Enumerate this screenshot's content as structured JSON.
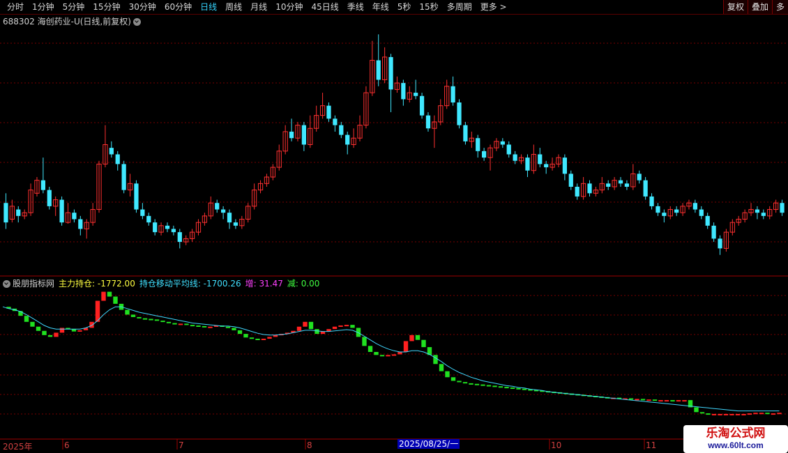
{
  "toolbar": {
    "tabs": [
      "分时",
      "1分钟",
      "5分钟",
      "15分钟",
      "30分钟",
      "60分钟",
      "日线",
      "周线",
      "月线",
      "10分钟",
      "45日线",
      "季线",
      "年线",
      "5秒",
      "15秒",
      "多周期",
      "更多 >"
    ],
    "active_tab": "日线",
    "right_buttons": [
      "复权",
      "叠加",
      "多"
    ]
  },
  "stock_title": "688302 海创药业-U(日线,前复权)",
  "indicator": {
    "name": "股朋指标网",
    "main_label": "主力持仓: -1772.00",
    "ma_label": "持仓移动平均线: -1700.26",
    "inc_label": "增: 31.47",
    "dec_label": "减: 0.00",
    "colors": {
      "main": "#ffff40",
      "ma": "#40e0ff",
      "inc": "#ff40ff",
      "dec": "#40ff40"
    }
  },
  "axis": {
    "labels": [
      "2025年",
      "6",
      "7",
      "8",
      "10",
      "11"
    ],
    "selected": "2025/08/25/一"
  },
  "watermark": {
    "line1": "乐淘公式网",
    "line2": "www.60lt.com"
  },
  "colors": {
    "up": "#ff3030",
    "down": "#40e8ff",
    "grid": "#7a0000",
    "ind_up": "#ff2020",
    "ind_down": "#20e020",
    "ma_line": "#40d8ff"
  },
  "chart_data": {
    "type": "candlestick",
    "candles": [
      [
        0.6,
        0.3,
        0.75,
        0.2
      ],
      [
        0.35,
        0.55,
        0.65,
        0.3
      ],
      [
        0.5,
        0.4,
        0.55,
        0.3
      ],
      [
        0.4,
        0.45,
        0.5,
        0.35
      ],
      [
        0.45,
        0.8,
        0.9,
        0.4
      ],
      [
        0.75,
        0.95,
        1.0,
        0.7
      ],
      [
        0.95,
        0.8,
        1.3,
        0.75
      ],
      [
        0.8,
        0.55,
        0.85,
        0.5
      ],
      [
        0.55,
        0.65,
        0.7,
        0.4
      ],
      [
        0.65,
        0.3,
        0.7,
        0.25
      ],
      [
        0.3,
        0.45,
        0.6,
        0.28
      ],
      [
        0.45,
        0.35,
        0.5,
        0.3
      ],
      [
        0.35,
        0.2,
        0.4,
        0.1
      ],
      [
        0.2,
        0.3,
        0.35,
        0.05
      ],
      [
        0.3,
        0.5,
        0.6,
        0.25
      ],
      [
        0.5,
        1.2,
        1.25,
        0.45
      ],
      [
        1.2,
        1.5,
        1.8,
        1.15
      ],
      [
        1.45,
        1.35,
        1.55,
        1.3
      ],
      [
        1.35,
        1.2,
        1.4,
        1.1
      ],
      [
        1.2,
        0.8,
        1.25,
        0.75
      ],
      [
        0.8,
        0.9,
        1.05,
        0.7
      ],
      [
        0.9,
        0.5,
        0.95,
        0.45
      ],
      [
        0.5,
        0.4,
        0.6,
        0.35
      ],
      [
        0.4,
        0.3,
        0.45,
        0.25
      ],
      [
        0.3,
        0.15,
        0.35,
        0.1
      ],
      [
        0.15,
        0.25,
        0.3,
        0.1
      ],
      [
        0.25,
        0.2,
        0.3,
        0.15
      ],
      [
        0.2,
        0.15,
        0.25,
        0.1
      ],
      [
        0.15,
        0.0,
        0.2,
        -0.1
      ],
      [
        0.0,
        0.05,
        0.1,
        -0.05
      ],
      [
        0.05,
        0.15,
        0.2,
        0.0
      ],
      [
        0.15,
        0.3,
        0.35,
        0.1
      ],
      [
        0.3,
        0.4,
        0.45,
        0.25
      ],
      [
        0.4,
        0.6,
        0.7,
        0.35
      ],
      [
        0.6,
        0.5,
        0.65,
        0.45
      ],
      [
        0.5,
        0.45,
        0.55,
        0.35
      ],
      [
        0.45,
        0.3,
        0.5,
        0.2
      ],
      [
        0.3,
        0.25,
        0.35,
        0.2
      ],
      [
        0.25,
        0.35,
        0.4,
        0.2
      ],
      [
        0.35,
        0.55,
        0.6,
        0.3
      ],
      [
        0.55,
        0.8,
        0.9,
        0.5
      ],
      [
        0.8,
        0.9,
        0.95,
        0.75
      ],
      [
        0.9,
        1.0,
        1.05,
        0.85
      ],
      [
        1.0,
        1.15,
        1.2,
        0.95
      ],
      [
        1.15,
        1.4,
        1.5,
        1.1
      ],
      [
        1.4,
        1.7,
        1.8,
        1.35
      ],
      [
        1.7,
        1.6,
        1.9,
        1.55
      ],
      [
        1.6,
        1.8,
        1.85,
        1.55
      ],
      [
        1.8,
        1.5,
        1.85,
        1.4
      ],
      [
        1.5,
        1.75,
        1.95,
        1.45
      ],
      [
        1.75,
        1.95,
        2.1,
        1.7
      ],
      [
        1.95,
        2.1,
        2.3,
        1.9
      ],
      [
        2.1,
        1.9,
        2.15,
        1.85
      ],
      [
        1.9,
        1.8,
        1.95,
        1.7
      ],
      [
        1.8,
        1.65,
        1.85,
        1.6
      ],
      [
        1.65,
        1.5,
        1.7,
        1.35
      ],
      [
        1.5,
        1.6,
        1.75,
        1.45
      ],
      [
        1.6,
        1.8,
        1.95,
        1.55
      ],
      [
        1.8,
        2.3,
        2.4,
        1.75
      ],
      [
        2.3,
        2.8,
        3.1,
        2.25
      ],
      [
        2.8,
        2.5,
        3.2,
        2.4
      ],
      [
        2.5,
        2.85,
        3.0,
        2.45
      ],
      [
        2.85,
        2.35,
        2.9,
        2.0
      ],
      [
        2.35,
        2.45,
        2.55,
        2.3
      ],
      [
        2.45,
        2.2,
        2.5,
        2.1
      ],
      [
        2.2,
        2.3,
        2.4,
        2.15
      ],
      [
        2.3,
        2.25,
        2.5,
        2.2
      ],
      [
        2.25,
        1.95,
        2.3,
        1.9
      ],
      [
        1.95,
        1.75,
        2.0,
        1.7
      ],
      [
        1.75,
        1.85,
        1.95,
        1.45
      ],
      [
        1.85,
        2.1,
        2.2,
        1.8
      ],
      [
        2.1,
        2.4,
        2.5,
        2.05
      ],
      [
        2.4,
        2.15,
        2.55,
        2.1
      ],
      [
        2.15,
        1.8,
        2.2,
        1.75
      ],
      [
        1.8,
        1.55,
        1.85,
        1.5
      ],
      [
        1.55,
        1.6,
        1.7,
        1.45
      ],
      [
        1.6,
        1.4,
        1.65,
        1.3
      ],
      [
        1.4,
        1.3,
        1.45,
        1.25
      ],
      [
        1.3,
        1.45,
        1.5,
        1.1
      ],
      [
        1.45,
        1.55,
        1.6,
        1.4
      ],
      [
        1.55,
        1.5,
        1.6,
        1.45
      ],
      [
        1.5,
        1.35,
        1.55,
        1.3
      ],
      [
        1.35,
        1.25,
        1.4,
        1.2
      ],
      [
        1.25,
        1.3,
        1.35,
        1.2
      ],
      [
        1.3,
        1.1,
        1.35,
        1.0
      ],
      [
        1.1,
        1.35,
        1.5,
        1.05
      ],
      [
        1.35,
        1.2,
        1.45,
        1.15
      ],
      [
        1.2,
        1.15,
        1.25,
        1.05
      ],
      [
        1.15,
        1.2,
        1.3,
        1.1
      ],
      [
        1.2,
        1.3,
        1.35,
        1.15
      ],
      [
        1.3,
        1.05,
        1.35,
        0.95
      ],
      [
        1.05,
        0.85,
        1.1,
        0.8
      ],
      [
        0.85,
        0.7,
        0.9,
        0.65
      ],
      [
        0.7,
        0.9,
        1.0,
        0.65
      ],
      [
        0.9,
        0.75,
        0.95,
        0.7
      ],
      [
        0.75,
        0.8,
        0.85,
        0.7
      ],
      [
        0.8,
        0.9,
        1.0,
        0.75
      ],
      [
        0.9,
        0.85,
        0.95,
        0.8
      ],
      [
        0.85,
        0.95,
        1.0,
        0.8
      ],
      [
        0.95,
        0.9,
        1.0,
        0.85
      ],
      [
        0.9,
        0.85,
        0.95,
        0.8
      ],
      [
        0.85,
        1.05,
        1.2,
        0.8
      ],
      [
        1.05,
        0.95,
        1.1,
        0.9
      ],
      [
        0.95,
        0.7,
        1.0,
        0.65
      ],
      [
        0.7,
        0.55,
        0.75,
        0.5
      ],
      [
        0.55,
        0.45,
        0.6,
        0.4
      ],
      [
        0.45,
        0.4,
        0.5,
        0.3
      ],
      [
        0.4,
        0.5,
        0.55,
        0.35
      ],
      [
        0.5,
        0.45,
        0.55,
        0.4
      ],
      [
        0.45,
        0.55,
        0.6,
        0.4
      ],
      [
        0.55,
        0.6,
        0.65,
        0.5
      ],
      [
        0.6,
        0.5,
        0.65,
        0.45
      ],
      [
        0.5,
        0.4,
        0.55,
        0.35
      ],
      [
        0.4,
        0.25,
        0.45,
        0.2
      ],
      [
        0.25,
        0.05,
        0.3,
        0.0
      ],
      [
        0.05,
        -0.1,
        0.1,
        -0.2
      ],
      [
        -0.1,
        0.15,
        0.2,
        -0.15
      ],
      [
        0.15,
        0.3,
        0.35,
        0.1
      ],
      [
        0.3,
        0.35,
        0.4,
        0.25
      ],
      [
        0.35,
        0.45,
        0.5,
        0.3
      ],
      [
        0.45,
        0.5,
        0.6,
        0.4
      ],
      [
        0.5,
        0.45,
        0.55,
        0.35
      ],
      [
        0.45,
        0.4,
        0.5,
        0.35
      ],
      [
        0.4,
        0.5,
        0.55,
        0.35
      ],
      [
        0.5,
        0.6,
        0.65,
        0.45
      ],
      [
        0.6,
        0.45,
        0.65,
        0.4
      ]
    ],
    "indicator_main": [
      -5,
      -8,
      -12,
      -20,
      -30,
      -38,
      -45,
      -52,
      -55,
      -48,
      -40,
      -42,
      -46,
      -44,
      -40,
      -30,
      5,
      20,
      12,
      0,
      -10,
      -18,
      -22,
      -24,
      -25,
      -26,
      -28,
      -30,
      -32,
      -34,
      -33,
      -35,
      -36,
      -37,
      -38,
      -38,
      -36,
      -38,
      -40,
      -44,
      -50,
      -56,
      -58,
      -60,
      -58,
      -55,
      -52,
      -50,
      -48,
      -45,
      -38,
      -30,
      -42,
      -50,
      -46,
      -42,
      -38,
      -36,
      -35,
      -40,
      -55,
      -70,
      -80,
      -85,
      -86,
      -85,
      -84,
      -80,
      -62,
      -52,
      -60,
      -72,
      -85,
      -100,
      -112,
      -122,
      -128,
      -130,
      -132,
      -133,
      -134,
      -135,
      -136,
      -137,
      -138,
      -139,
      -140,
      -141,
      -142,
      -143,
      -144,
      -145,
      -146,
      -147,
      -148,
      -149,
      -150,
      -151,
      -152,
      -153,
      -154,
      -155,
      -156,
      -156,
      -157,
      -157,
      -158,
      -158,
      -159,
      -159,
      -160,
      -160,
      -160,
      -161,
      -160,
      -160,
      -172,
      -180,
      -182,
      -183,
      -183,
      -183,
      -183,
      -183,
      -183,
      -183,
      -182,
      -181,
      -181,
      -182,
      -182,
      -181
    ],
    "indicator_ma": [
      -5,
      -8,
      -10,
      -13,
      -18,
      -24,
      -30,
      -36,
      -40,
      -42,
      -42,
      -42,
      -42,
      -42,
      -40,
      -36,
      -28,
      -18,
      -10,
      -5,
      -5,
      -8,
      -11,
      -14,
      -16,
      -18,
      -20,
      -22,
      -24,
      -26,
      -28,
      -30,
      -32,
      -33,
      -34,
      -35,
      -36,
      -37,
      -37,
      -38,
      -40,
      -43,
      -46,
      -49,
      -51,
      -52,
      -52,
      -51,
      -50,
      -48,
      -46,
      -44,
      -44,
      -45,
      -46,
      -46,
      -45,
      -44,
      -43,
      -44,
      -48,
      -54,
      -60,
      -66,
      -71,
      -75,
      -78,
      -80,
      -80,
      -78,
      -78,
      -80,
      -84,
      -90,
      -96,
      -103,
      -109,
      -114,
      -118,
      -122,
      -125,
      -128,
      -130,
      -132,
      -134,
      -136,
      -137,
      -139,
      -140,
      -142,
      -143,
      -144,
      -146,
      -147,
      -148,
      -149,
      -150,
      -151,
      -152,
      -153,
      -154,
      -155,
      -156,
      -157,
      -158,
      -159,
      -160,
      -161,
      -162,
      -163,
      -164,
      -165,
      -166,
      -167,
      -168,
      -169,
      -170,
      -171,
      -172,
      -173,
      -174,
      -175,
      -176,
      -177,
      -178,
      -178,
      -178,
      -178,
      -178,
      -178,
      -178,
      -178
    ]
  }
}
